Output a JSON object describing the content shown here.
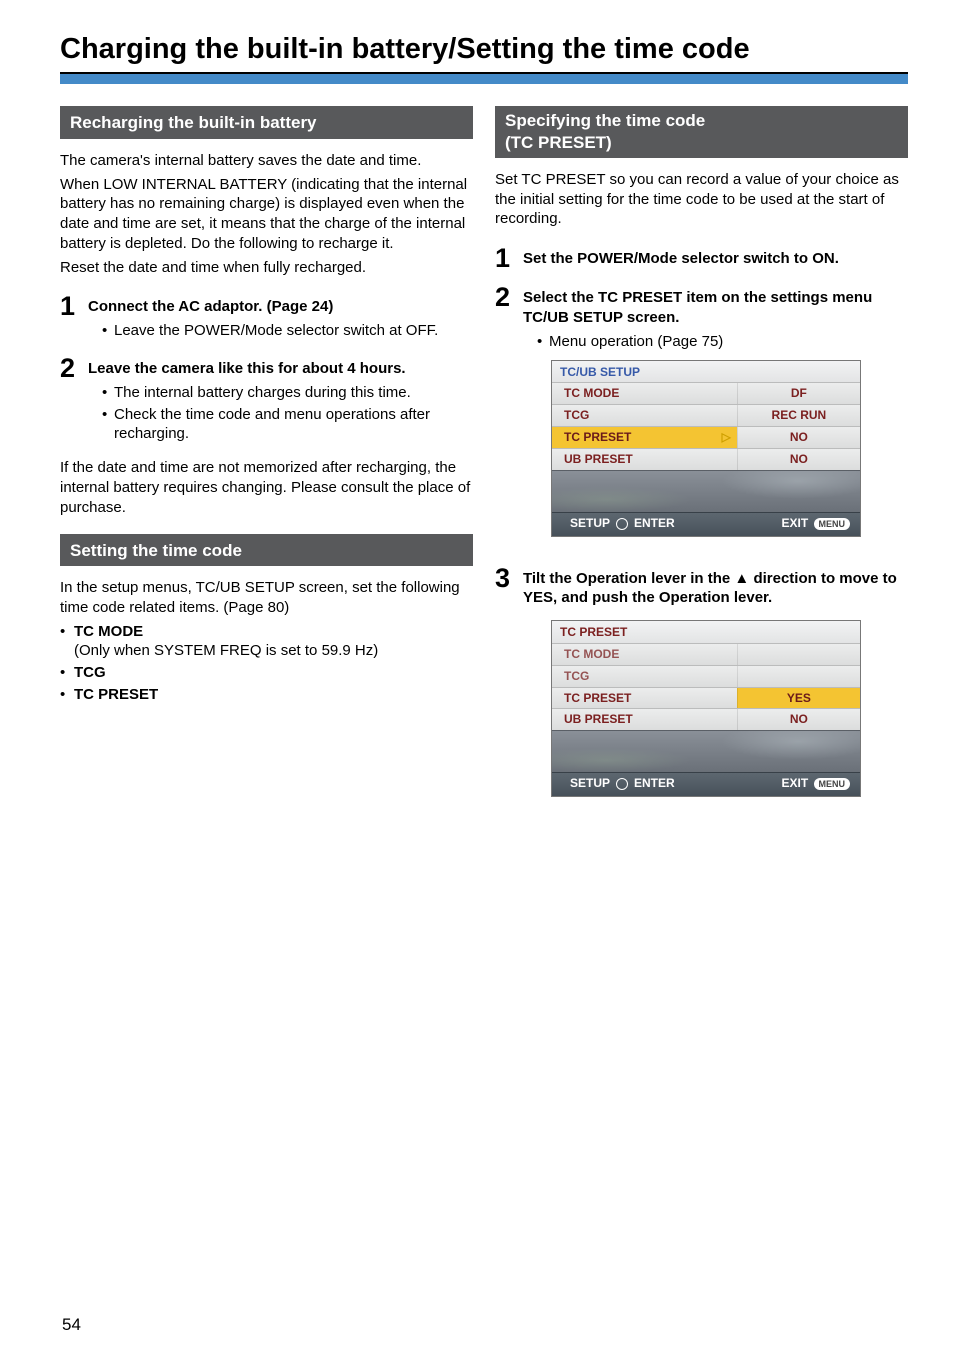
{
  "page_number": "54",
  "page_title": "Charging the built-in battery/Setting the time code",
  "left": {
    "section1_header": "Recharging the built-in battery",
    "intro1": "The camera's internal battery saves the date and time.",
    "intro2": "When LOW INTERNAL BATTERY (indicating that the internal battery has no remaining charge) is displayed even when the date and time are set, it means that the charge of the internal battery is depleted. Do the following to recharge it.",
    "intro3": "Reset the date and time when fully recharged.",
    "step1_title": "Connect the AC adaptor. (Page 24)",
    "step1_b1": "Leave the POWER/Mode selector switch at OFF.",
    "step2_title": "Leave the camera like this for about 4 hours.",
    "step2_b1": "The internal battery charges during this time.",
    "step2_b2": "Check the time code and menu operations after recharging.",
    "closing": "If the date and time are not memorized after recharging, the internal battery requires changing. Please consult the place of purchase.",
    "section2_header": "Setting the time code",
    "tc_intro": "In the setup menus, TC/UB SETUP screen, set the following time code related items. (Page 80)",
    "tc_item1": "TC MODE",
    "tc_note1": "(Only when SYSTEM FREQ is set to 59.9 Hz)",
    "tc_item2": "TCG",
    "tc_item3": "TC PRESET"
  },
  "right": {
    "section_header_line1": "Specifying the time code",
    "section_header_line2": "(TC PRESET)",
    "intro": "Set TC PRESET so you can record a value of your choice as the initial setting for the time code to be used at the start of recording.",
    "step1_title": "Set the POWER/Mode selector switch to ON.",
    "step2_title": "Select the TC PRESET item on the settings menu TC/UB SETUP screen.",
    "step2_b1": "Menu operation (Page 75)",
    "step3_title": "Tilt the Operation lever in the ▲ direction to move to YES, and push the Operation lever.",
    "screen1": {
      "title": "TC/UB SETUP",
      "rows": [
        {
          "left": "TC MODE",
          "right": "DF"
        },
        {
          "left": "TCG",
          "right": "REC RUN"
        },
        {
          "left": "TC PRESET",
          "right": "NO",
          "highlight": true,
          "cursor": "▷"
        },
        {
          "left": "UB PRESET",
          "right": "NO"
        }
      ],
      "footer_left_a": "SETUP",
      "footer_left_b": "ENTER",
      "footer_right": "EXIT",
      "footer_badge": "MENU"
    },
    "screen2": {
      "title": "TC PRESET",
      "rows": [
        {
          "left": "TC MODE",
          "right": ""
        },
        {
          "left": "TCG",
          "right": ""
        },
        {
          "left": "TC PRESET",
          "right": "YES",
          "right_hl": true
        },
        {
          "left": "UB PRESET",
          "right": "NO"
        }
      ],
      "footer_left_a": "SETUP",
      "footer_left_b": "ENTER",
      "footer_right": "EXIT",
      "footer_badge": "MENU"
    }
  },
  "nums": {
    "n1": "1",
    "n2": "2",
    "n3": "3"
  }
}
